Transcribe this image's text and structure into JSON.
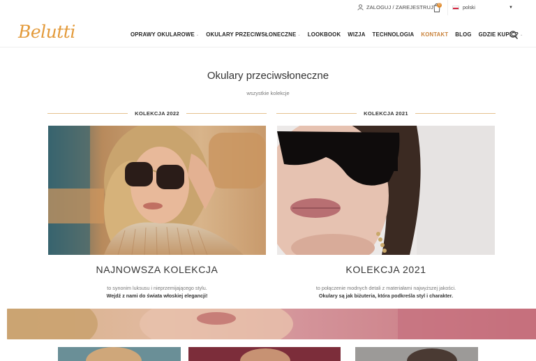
{
  "topbar": {
    "login_label": "ZALOGUJ / ZAREJESTRUJ",
    "cart_count": "0",
    "language": "polski"
  },
  "header": {
    "logo_text": "Belutti",
    "nav": [
      {
        "label": "OPRAWY OKULAROWE",
        "dropdown": true
      },
      {
        "label": "OKULARY PRZECIWSŁONECZNE",
        "dropdown": true
      },
      {
        "label": "LOOKBOOK",
        "dropdown": false
      },
      {
        "label": "WIZJA",
        "dropdown": false
      },
      {
        "label": "TECHNOLOGIA",
        "dropdown": false
      },
      {
        "label": "KONTAKT",
        "dropdown": false,
        "active": true
      },
      {
        "label": "BLOG",
        "dropdown": false
      },
      {
        "label": "GDZIE KUPIĆ?",
        "dropdown": true
      }
    ]
  },
  "main": {
    "title": "Okulary przeciwsłoneczne",
    "subtitle": "wszystkie kolekcje",
    "collections": [
      {
        "section_label": "KOLEKCJA 2022",
        "title": "NAJNOWSZA KOLEKCJA",
        "desc_line1": "to synonim luksusu i nieprzemijającego stylu.",
        "desc_line2": "Wejdź z nami do świata włoskiej elegancji!"
      },
      {
        "section_label": "KOLEKCJA 2021",
        "title": "KOLEKCJA 2021",
        "desc_line1": "to połączenie modnych detali z materiałami najwyższej jakości.",
        "desc_line2": "Okulary są jak biżuteria, która podkreśla styl i charakter."
      }
    ]
  },
  "icons": {
    "user": "user-icon",
    "cart": "shopping-bag-icon",
    "search": "search-icon",
    "flag": "poland-flag-icon",
    "caret": "caret-down-icon"
  },
  "colors": {
    "accent": "#c9823a",
    "logo": "#e39a3a",
    "divider": "#e5c18f",
    "badge": "#e08a2c"
  }
}
